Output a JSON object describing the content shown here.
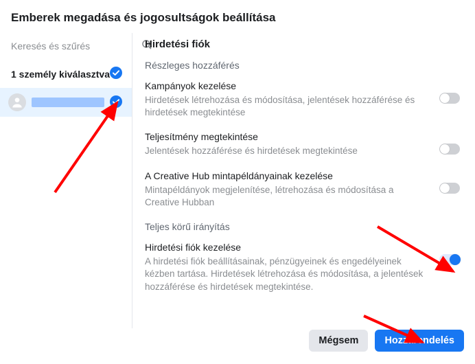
{
  "header": {
    "title": "Emberek megadása és jogosultságok beállítása"
  },
  "sidebar": {
    "search_placeholder": "Keresés és szűrés",
    "selected_label": "1 személy kiválasztva"
  },
  "main": {
    "heading": "Hirdetési fiók",
    "sections": [
      {
        "title": "Részleges hozzáférés",
        "perms": [
          {
            "title": "Kampányok kezelése",
            "desc": "Hirdetések létrehozása és módosítása, jelentések hozzáférése és hirdetések megtekintése",
            "on": false
          },
          {
            "title": "Teljesítmény megtekintése",
            "desc": "Jelentések hozzáférése és hirdetések megtekintése",
            "on": false
          },
          {
            "title": "A Creative Hub mintapéldányainak kezelése",
            "desc": "Mintapéldányok megjelenítése, létrehozása és módosítása a Creative Hubban",
            "on": false
          }
        ]
      },
      {
        "title": "Teljes körű irányítás",
        "perms": [
          {
            "title": "Hirdetési fiók kezelése",
            "desc": "A hirdetési fiók beállításainak, pénzügyeinek és engedélyeinek kézben tartása. Hirdetések létrehozása és módosítása, a jelentések hozzáférése és hirdetések megtekintése.",
            "on": true
          }
        ]
      }
    ]
  },
  "footer": {
    "cancel": "Mégsem",
    "assign": "Hozzárendelés"
  }
}
